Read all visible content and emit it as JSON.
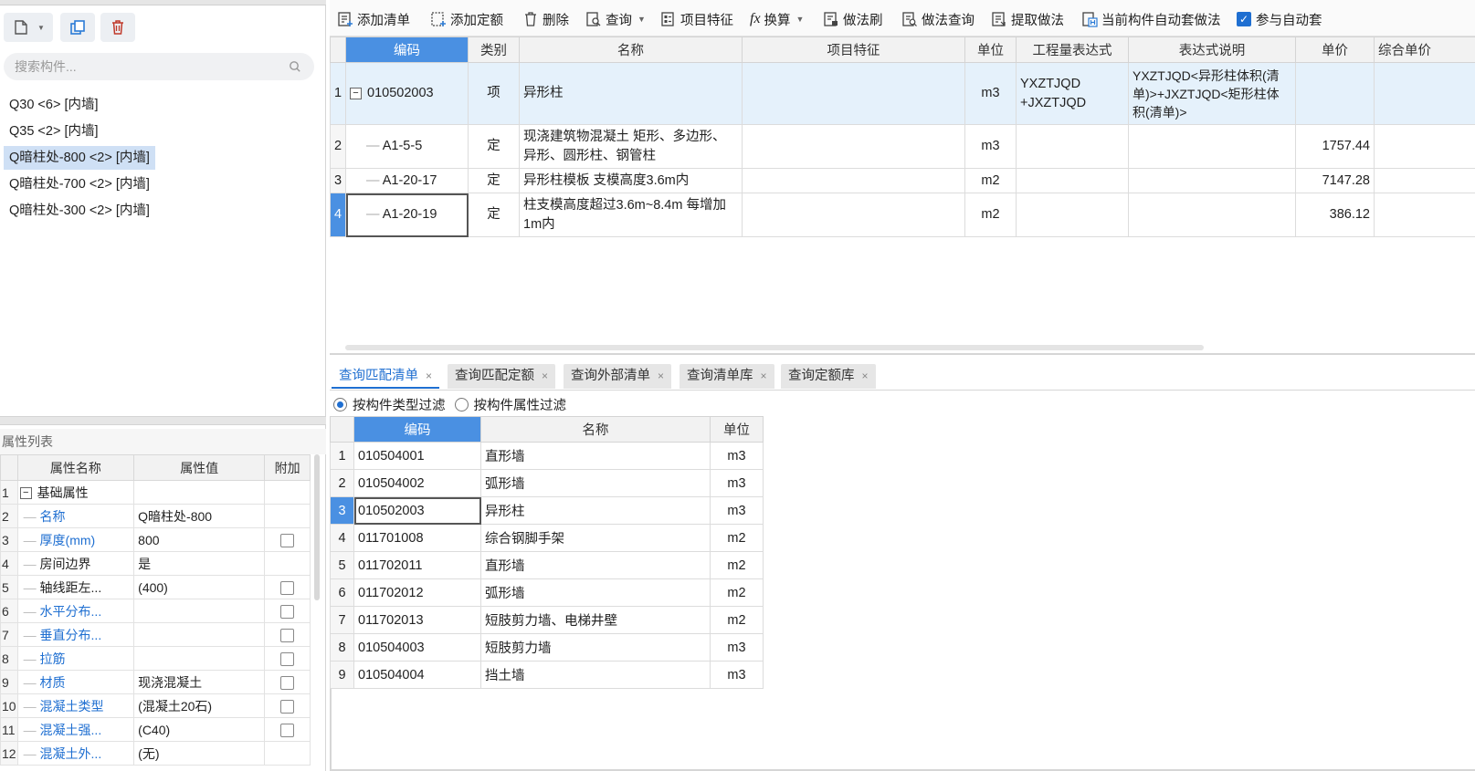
{
  "left": {
    "search_placeholder": "搜索构件...",
    "components": [
      {
        "label": "Q30 <6> [内墙]",
        "selected": false
      },
      {
        "label": "Q35 <2> [内墙]",
        "selected": false
      },
      {
        "label": "Q暗柱处-800 <2> [内墙]",
        "selected": true
      },
      {
        "label": "Q暗柱处-700 <2> [内墙]",
        "selected": false
      },
      {
        "label": "Q暗柱处-300 <2> [内墙]",
        "selected": false
      }
    ],
    "prop_title": "属性列表",
    "prop_headers": [
      "属性名称",
      "属性值",
      "附加"
    ],
    "props": [
      {
        "n": "1",
        "name": "基础属性",
        "value": "",
        "blue": false,
        "group": true,
        "check": false
      },
      {
        "n": "2",
        "name": "名称",
        "value": "Q暗柱处-800",
        "blue": true,
        "group": false,
        "check": false
      },
      {
        "n": "3",
        "name": "厚度(mm)",
        "value": "800",
        "blue": true,
        "group": false,
        "check": true
      },
      {
        "n": "4",
        "name": "房间边界",
        "value": "是",
        "blue": false,
        "group": false,
        "check": false
      },
      {
        "n": "5",
        "name": "轴线距左...",
        "value": "(400)",
        "blue": false,
        "group": false,
        "check": true
      },
      {
        "n": "6",
        "name": "水平分布...",
        "value": "",
        "blue": true,
        "group": false,
        "check": true
      },
      {
        "n": "7",
        "name": "垂直分布...",
        "value": "",
        "blue": true,
        "group": false,
        "check": true
      },
      {
        "n": "8",
        "name": "拉筋",
        "value": "",
        "blue": true,
        "group": false,
        "check": true
      },
      {
        "n": "9",
        "name": "材质",
        "value": "现浇混凝土",
        "blue": true,
        "group": false,
        "check": true
      },
      {
        "n": "10",
        "name": "混凝土类型",
        "value": "(混凝土20石)",
        "blue": true,
        "group": false,
        "check": true
      },
      {
        "n": "11",
        "name": "混凝土强...",
        "value": "(C40)",
        "blue": true,
        "group": false,
        "check": true
      },
      {
        "n": "12",
        "name": "混凝土外...",
        "value": "(无)",
        "blue": true,
        "group": false,
        "check": false
      }
    ]
  },
  "toolbar": {
    "add_list": "添加清单",
    "add_quota": "添加定额",
    "delete": "删除",
    "query": "查询",
    "item_feature": "项目特征",
    "convert": "换算",
    "method_brush": "做法刷",
    "method_query": "做法查询",
    "extract_method": "提取做法",
    "auto_method": "当前构件自动套做法",
    "join_auto": "参与自动套"
  },
  "main_grid": {
    "headers": [
      "编码",
      "类别",
      "名称",
      "项目特征",
      "单位",
      "工程量表达式",
      "表达式说明",
      "单价",
      "综合单价"
    ],
    "rows": [
      {
        "n": "1",
        "code": "010502003",
        "type": "项",
        "name": "异形柱",
        "feature": "",
        "unit": "m3",
        "expr": "YXZTJQD +JXZTJQD",
        "desc": "YXZTJQD<异形柱体积(清单)>+JXZTJQD<矩形柱体积(清单)>",
        "price": ""
      },
      {
        "n": "2",
        "code": "A1-5-5",
        "type": "定",
        "name": "现浇建筑物混凝土 矩形、多边形、异形、圆形柱、钢管柱",
        "feature": "",
        "unit": "m3",
        "expr": "",
        "desc": "",
        "price": "1757.44"
      },
      {
        "n": "3",
        "code": "A1-20-17",
        "type": "定",
        "name": "异形柱模板 支模高度3.6m内",
        "feature": "",
        "unit": "m2",
        "expr": "",
        "desc": "",
        "price": "7147.28"
      },
      {
        "n": "4",
        "code": "A1-20-19",
        "type": "定",
        "name": "柱支模高度超过3.6m~8.4m 每增加1m内",
        "feature": "",
        "unit": "m2",
        "expr": "",
        "desc": "",
        "price": "386.12"
      }
    ]
  },
  "tabs": [
    {
      "label": "查询匹配清单",
      "active": true
    },
    {
      "label": "查询匹配定额",
      "active": false
    },
    {
      "label": "查询外部清单",
      "active": false
    },
    {
      "label": "查询清单库",
      "active": false
    },
    {
      "label": "查询定额库",
      "active": false
    }
  ],
  "filter": {
    "by_type": "按构件类型过滤",
    "by_attr": "按构件属性过滤"
  },
  "query_grid": {
    "headers": [
      "编码",
      "名称",
      "单位"
    ],
    "rows": [
      {
        "n": "1",
        "code": "010504001",
        "name": "直形墙",
        "unit": "m3"
      },
      {
        "n": "2",
        "code": "010504002",
        "name": "弧形墙",
        "unit": "m3"
      },
      {
        "n": "3",
        "code": "010502003",
        "name": "异形柱",
        "unit": "m3"
      },
      {
        "n": "4",
        "code": "011701008",
        "name": "综合钢脚手架",
        "unit": "m2"
      },
      {
        "n": "5",
        "code": "011702011",
        "name": "直形墙",
        "unit": "m2"
      },
      {
        "n": "6",
        "code": "011702012",
        "name": "弧形墙",
        "unit": "m2"
      },
      {
        "n": "7",
        "code": "011702013",
        "name": "短肢剪力墙、电梯井壁",
        "unit": "m2"
      },
      {
        "n": "8",
        "code": "010504003",
        "name": "短肢剪力墙",
        "unit": "m3"
      },
      {
        "n": "9",
        "code": "010504004",
        "name": "挡土墙",
        "unit": "m3"
      }
    ]
  },
  "colors": {
    "accent": "#4a90e2",
    "link": "#1f6fd1",
    "selected_bg": "#e5f1fb"
  }
}
